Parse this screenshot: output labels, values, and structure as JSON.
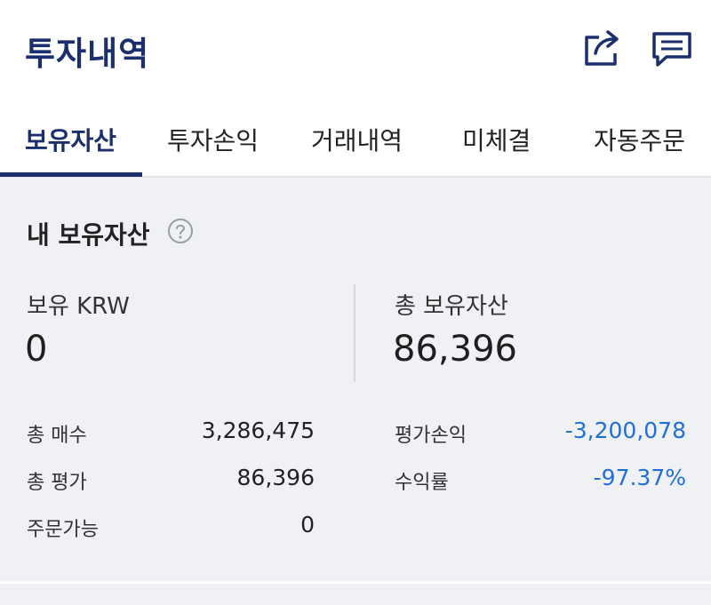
{
  "header": {
    "title": "투자내역",
    "share_icon": "share-icon",
    "chat_icon": "chat-icon"
  },
  "tabs": [
    {
      "label": "보유자산",
      "active": true
    },
    {
      "label": "투자손익",
      "active": false
    },
    {
      "label": "거래내역",
      "active": false
    },
    {
      "label": "미체결",
      "active": false
    },
    {
      "label": "자동주문",
      "active": false
    }
  ],
  "summary": {
    "title": "내 보유자산",
    "help_icon": "help-icon",
    "krw_label": "보유 KRW",
    "krw_value": "0",
    "total_label": "총 보유자산",
    "total_value": "86,396"
  },
  "details_left": [
    {
      "label": "총 매수",
      "value": "3,286,475"
    },
    {
      "label": "총 평가",
      "value": "86,396"
    },
    {
      "label": "주문가능",
      "value": "0"
    }
  ],
  "details_right": [
    {
      "label": "평가손익",
      "value": "-3,200,078"
    },
    {
      "label": "수익률",
      "value": "-97.37%"
    }
  ],
  "colors": {
    "brand": "#1b2f6e",
    "negative": "#1f6fd6",
    "background": "#f0f1f5"
  }
}
